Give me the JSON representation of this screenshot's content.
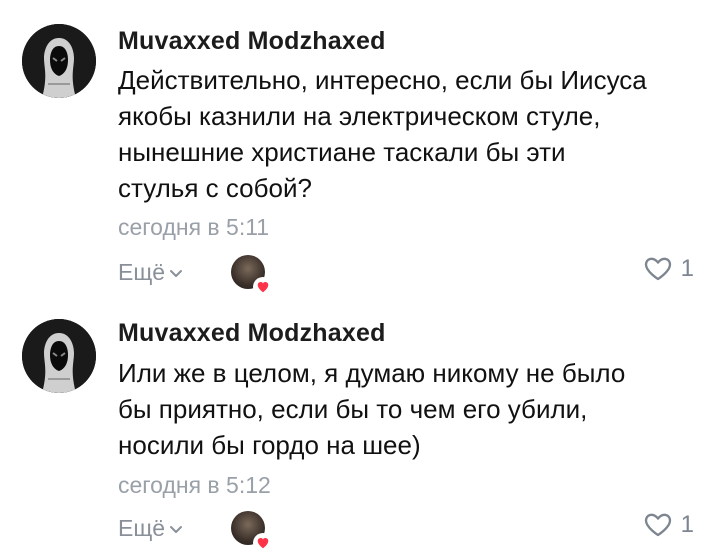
{
  "comments": [
    {
      "author": "Muvaxxed Modzhaxed",
      "text_lines": [
        "Действительно, интересно, если бы Иисуса",
        "якобы казнили на электрическом стуле,",
        "нынешние христиане таскали бы эти",
        "стулья с собой?"
      ],
      "time": "сегодня в 5:11",
      "more_label": "Ещё",
      "like_count": "1"
    },
    {
      "author": "Muvaxxed Modzhaxed",
      "text_lines": [
        "Или же в целом, я думаю никому не было",
        "бы приятно, если бы то чем его убили,",
        "носили бы гордо на шее)"
      ],
      "time": "сегодня в 5:12",
      "more_label": "Ещё",
      "like_count": "1"
    }
  ],
  "colors": {
    "author": "#1c1c1c",
    "text": "#111111",
    "time": "#9aa0a8",
    "more": "#8a9099",
    "heart_badge": "#ff3347",
    "like_outline": "#7d8590"
  },
  "icons": {
    "avatar": "hooded-figure-avatar",
    "more": "chevron-down-icon",
    "liker_badge": "heart-icon",
    "like": "heart-outline-icon"
  }
}
